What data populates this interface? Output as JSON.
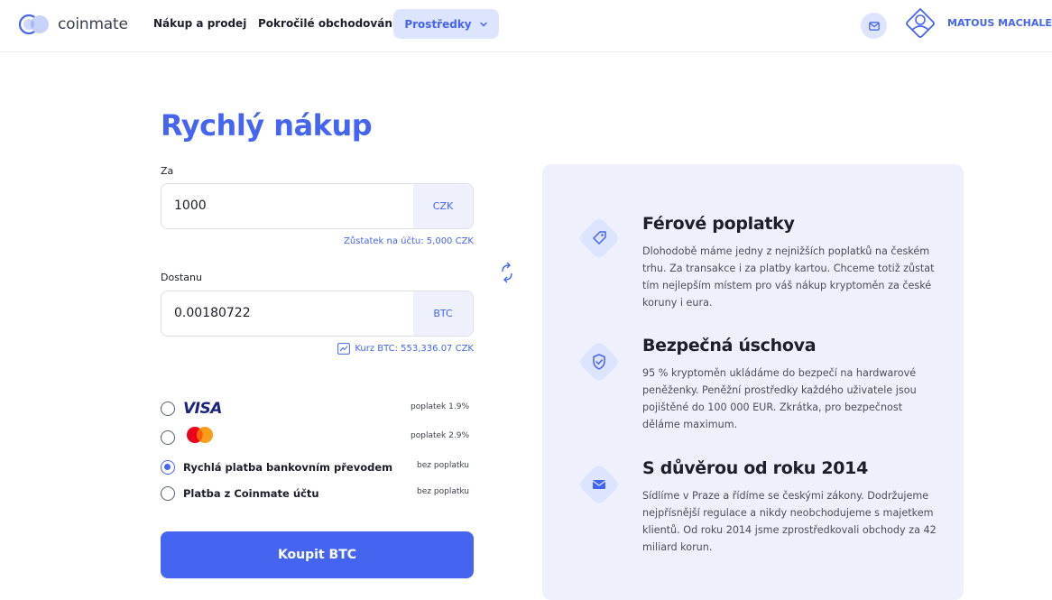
{
  "header": {
    "logo_text": "coinmate",
    "nav": {
      "buy_sell": "Nákup a prodej",
      "advanced": "Pokročilé obchodování",
      "funds": "Prostředky"
    },
    "user_name": "MATOUS MACHALEK"
  },
  "form": {
    "title": "Rychlý nákup",
    "za_label": "Za",
    "za_value": "1000",
    "za_currency": "CZK",
    "balance_hint": "Zůstatek na účtu: 5,000 CZK",
    "dostanu_label": "Dostanu",
    "dostanu_value": "0.00180722",
    "dostanu_currency": "BTC",
    "rate_hint": "Kurz BTC: 553,336.07 CZK",
    "payment_methods": [
      {
        "label": "VISA",
        "fee": "poplatek 1.9%",
        "selected": false
      },
      {
        "label": "mastercard",
        "fee": "poplatek 2.9%",
        "selected": false
      },
      {
        "label": "Rychlá platba bankovním převodem",
        "fee": "bez poplatku",
        "selected": true
      },
      {
        "label": "Platba z Coinmate účtu",
        "fee": "bez poplatku",
        "selected": false
      }
    ],
    "buy_button": "Koupit BTC"
  },
  "features": [
    {
      "icon": "tag-icon",
      "title": "Férové poplatky",
      "text": "Dlohodobě máme jedny z nejnižších poplatků na českém trhu. Za transakce i za platby kartou. Chceme totiž zůstat tím nejlepším místem pro váš nákup kryptoměn za české koruny i eura."
    },
    {
      "icon": "shield-check-icon",
      "title": "Bezpečná úschova",
      "text": "95 % kryptoměn ukládáme do bezpečí na hardwarové peněženky. Peněžní prostředky každého uživatele jsou pojištěné do 100 000 EUR. Zkrátka, pro bezpečnost děláme maximum."
    },
    {
      "icon": "envelope-icon",
      "title": "S důvěrou od roku 2014",
      "text": "Sídlíme v Praze a řídíme se českými zákony. Dodržujeme nejpřísnější regulace a nikdy neobchodujeme s majetkem klientů. Od roku 2014 jsme zprostředkovali obchody za 42 miliard korun."
    }
  ],
  "colors": {
    "accent": "#4565f0",
    "accent_light": "#dde4fd",
    "panel_bg": "#eef1fb"
  }
}
